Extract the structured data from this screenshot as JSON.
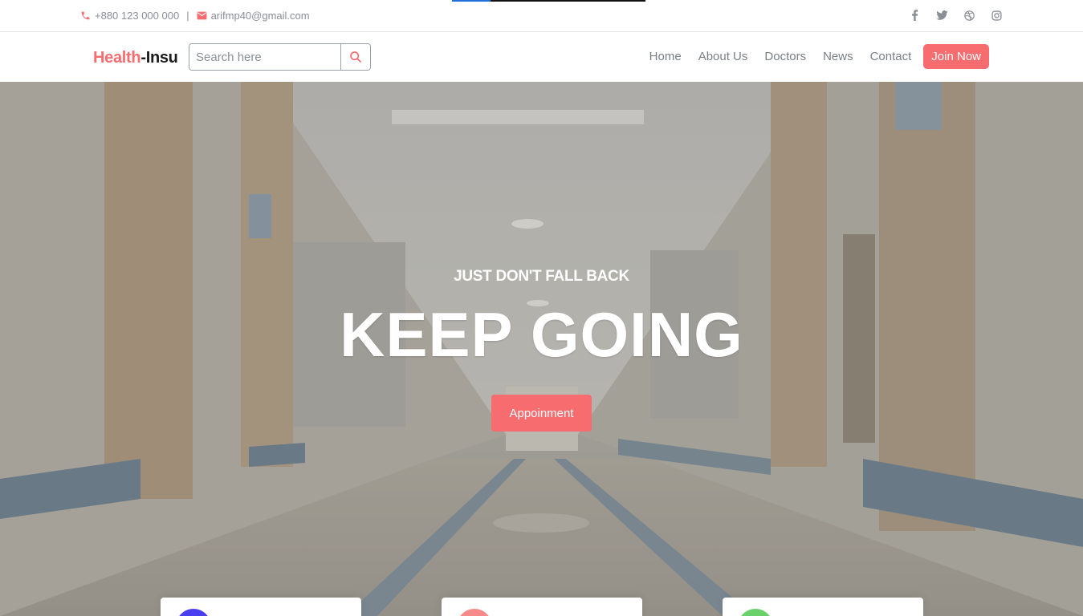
{
  "topbar": {
    "phone": "+880 123 000 000",
    "separator": "|",
    "email": "arifmp40@gmail.com",
    "social_icons": [
      "facebook-icon",
      "twitter-icon",
      "dribbble-icon",
      "instagram-icon"
    ]
  },
  "navbar": {
    "logo_part1": "Health",
    "logo_part2": "-Insu",
    "search_placeholder": "Search here",
    "menu": [
      "Home",
      "About Us",
      "Doctors",
      "News",
      "Contact"
    ],
    "join_label": "Join Now"
  },
  "hero": {
    "tagline": "JUST DON'T FALL BACK",
    "headline": "KEEP GOING",
    "button_label": "Appoinment"
  },
  "cards": [
    {
      "icon_color": "#4a3ff0"
    },
    {
      "icon_color": "#f78b8b"
    },
    {
      "icon_color": "#6ad16b"
    }
  ],
  "colors": {
    "accent": "#f76c6f",
    "muted_text": "#7a7f86"
  }
}
